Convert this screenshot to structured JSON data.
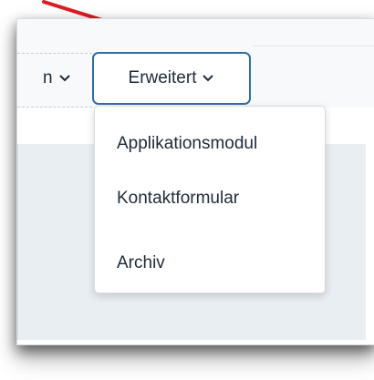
{
  "nav": {
    "partial_item_label": "n",
    "active_item_label": "Erweitert"
  },
  "dropdown": {
    "items": [
      {
        "label": "Applikationsmodul"
      },
      {
        "label": "Kontaktformular"
      },
      {
        "label": "Archiv"
      }
    ]
  },
  "colors": {
    "annotation_arrow": "#e01b22",
    "active_border": "#2f6fa8",
    "panel_background": "#e9eef3",
    "text": "#1e2a38"
  },
  "icons": {
    "dropdown_chevron": "chevron-down-icon",
    "annotation": "arrow-icon"
  }
}
